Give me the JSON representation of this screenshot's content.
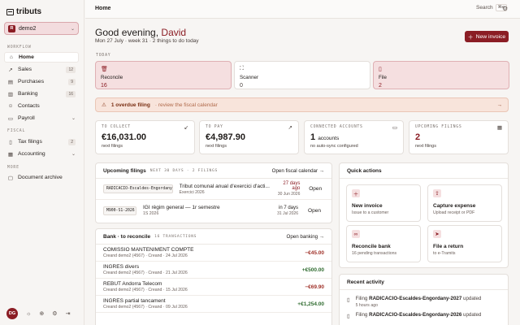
{
  "brand": "tributs",
  "org": {
    "badge": "R",
    "name": "demo2"
  },
  "sidebar": {
    "workflow_label": "WORKFLOW",
    "fiscal_label": "FISCAL",
    "more_label": "MORE",
    "items": [
      {
        "label": "Home",
        "icon": "home-icon",
        "count": ""
      },
      {
        "label": "Sales",
        "icon": "trend-icon",
        "count": "12"
      },
      {
        "label": "Purchases",
        "icon": "cart-icon",
        "count": "9"
      },
      {
        "label": "Banking",
        "icon": "bank-icon",
        "count": "16"
      },
      {
        "label": "Contacts",
        "icon": "users-icon",
        "count": ""
      },
      {
        "label": "Payroll",
        "icon": "wallet-icon",
        "count": ""
      },
      {
        "label": "Tax filings",
        "icon": "document-icon",
        "count": "2"
      },
      {
        "label": "Accounting",
        "icon": "book-icon",
        "count": ""
      },
      {
        "label": "Document archive",
        "icon": "folder-icon",
        "count": ""
      }
    ],
    "avatar_initials": "DG"
  },
  "topbar": {
    "crumb": "Home",
    "search_label": "Search",
    "search_kbd": "⌘K"
  },
  "greeting": {
    "prefix": "Good evening,",
    "name": "David"
  },
  "date_line": "Mon 27 July · week 31 · 2 things to do today",
  "new_invoice_label": "New invoice",
  "today_label": "TODAY",
  "today_cards": [
    {
      "label": "Reconcile",
      "value": "16"
    },
    {
      "label": "Scanner",
      "value": "0"
    },
    {
      "label": "File",
      "value": "2"
    }
  ],
  "alert": {
    "bold": "1 overdue filing",
    "rest": "· review the fiscal calendar"
  },
  "stats": [
    {
      "label": "TO COLLECT",
      "value": "€16,031.00",
      "unit": "",
      "sub": "next filings"
    },
    {
      "label": "TO PAY",
      "value": "€4,987.90",
      "unit": "",
      "sub": "next filings"
    },
    {
      "label": "CONNECTED ACCOUNTS",
      "value": "1",
      "unit": "accounts",
      "sub": "no auto-sync configured"
    },
    {
      "label": "UPCOMING FILINGS",
      "value": "2",
      "unit": "",
      "sub": "next filings"
    }
  ],
  "filings": {
    "title": "Upcoming filings",
    "meta": "NEXT 30 DAYS · 2 FILINGS",
    "link": "Open fiscal calendar",
    "rows": [
      {
        "code": "RADICACIO-Escaldes-Engordany-2026",
        "title": "Tribut comunal anual d'exercici d'acti...",
        "sub": "Exercici 2026",
        "due": "27 days ago",
        "date": "30 Jun 2026",
        "action": "Open"
      },
      {
        "code": "M900-S1-2026",
        "title": "IGI règim general — 1r semestre",
        "sub": "1S 2026",
        "due": "in 7 days",
        "date": "31 Jul 2026",
        "action": "Open"
      }
    ]
  },
  "bank": {
    "title": "Bank · to reconcile",
    "meta": "16 TRANSACTIONS",
    "link": "Open banking",
    "rows": [
      {
        "name": "COMISSIO MANTENIMENT COMPTE",
        "sub": "Creand demo2 (4567) · Creand · 24 Jul 2026",
        "amount": "−€45.00",
        "sign": "neg"
      },
      {
        "name": "INGRES divers",
        "sub": "Creand demo2 (4567) · Creand · 21 Jul 2026",
        "amount": "+€500.00",
        "sign": "pos"
      },
      {
        "name": "REBUT Andorra Telecom",
        "sub": "Creand demo2 (4567) · Creand · 15 Jul 2026",
        "amount": "−€69.90",
        "sign": "neg"
      },
      {
        "name": "INGRES partial tancament",
        "sub": "Creand demo2 (4567) · Creand · 09 Jul 2026",
        "amount": "+€1,254.00",
        "sign": "pos"
      }
    ]
  },
  "quick_actions": {
    "title": "Quick actions",
    "items": [
      {
        "icon": "plus-icon",
        "title": "New invoice",
        "sub": "Issue to a customer"
      },
      {
        "icon": "upload-icon",
        "title": "Capture expense",
        "sub": "Upload receipt or PDF"
      },
      {
        "icon": "link-icon",
        "title": "Reconcile bank",
        "sub": "16 pending transactions"
      },
      {
        "icon": "send-icon",
        "title": "File a return",
        "sub": "to e-Tramits"
      }
    ]
  },
  "activity": {
    "title": "Recent activity",
    "rows": [
      {
        "pre": "Filing",
        "code": "RADICACIO-Escaldes-Engordany-2027",
        "post": "updated",
        "time": "5 hours ago"
      },
      {
        "pre": "Filing",
        "code": "RADICACIO-Escaldes-Engordany-2026",
        "post": "updated",
        "time": ""
      }
    ]
  }
}
